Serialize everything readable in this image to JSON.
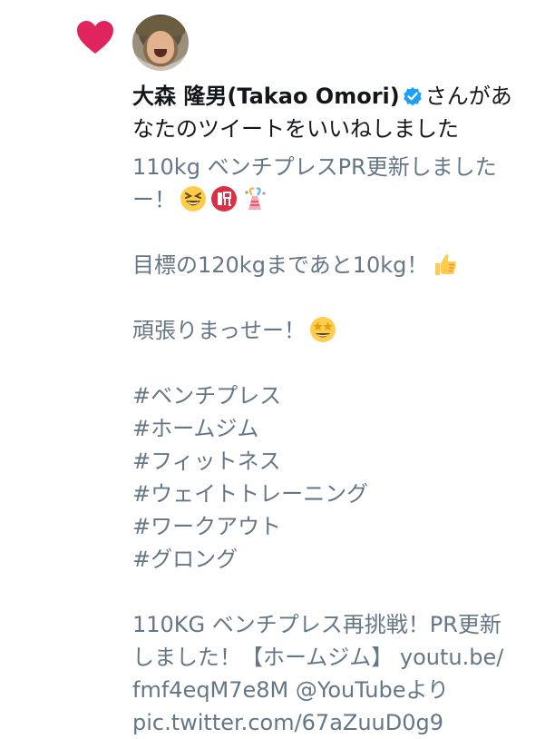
{
  "notification": {
    "liker_name": "大森 隆男(Takao Omori)",
    "action_text_1": "さんがあ",
    "action_text_2": "なたのツイートをいいねしました"
  },
  "tweet": {
    "lines": [
      "110kg ベンチプレスPR更新しました",
      "ー！",
      "目標の120kgまであと10kg！",
      "頑張りまっせー！",
      "#ベンチプレス",
      "#ホームジム",
      "#フィットネス",
      "#ウェイトトレーニング",
      "#ワークアウト",
      "#グロング",
      "110KG ベンチプレス再挑戦！PR更新",
      "しました！【ホームジム】 youtu.be/",
      "fmf4eqM7e8M @YouTubeより",
      "pic.twitter.com/67aZuuD0g9"
    ]
  }
}
